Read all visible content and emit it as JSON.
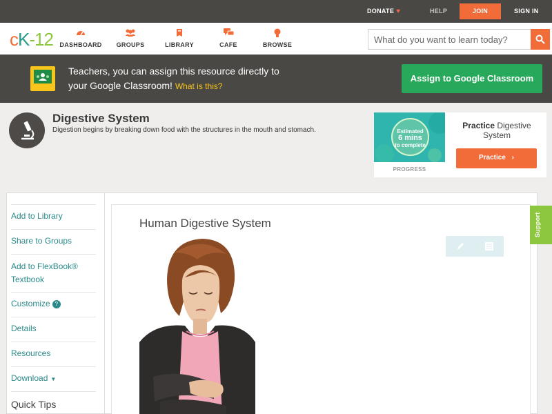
{
  "topbar": {
    "donate": "DONATE",
    "help": "HELP",
    "join": "JOIN",
    "signin": "SIGN IN"
  },
  "logo": {
    "c": "c",
    "k": "K",
    "dash": "-",
    "num": "12"
  },
  "nav": {
    "items": [
      {
        "label": "DASHBOARD",
        "icon": "dashboard-icon"
      },
      {
        "label": "GROUPS",
        "icon": "groups-icon"
      },
      {
        "label": "LIBRARY",
        "icon": "library-icon"
      },
      {
        "label": "CAFE",
        "icon": "cafe-icon"
      },
      {
        "label": "BROWSE",
        "icon": "browse-icon"
      }
    ],
    "search_placeholder": "What do you want to learn today?"
  },
  "banner": {
    "line1": "Teachers, you can assign this resource directly to",
    "line2": "your Google Classroom!",
    "what": "What is this?",
    "assign": "Assign to Google Classroom"
  },
  "concept": {
    "title": "Digestive System",
    "description": "Digestion begins by breaking down food with the structures in the mouth and stomach."
  },
  "practice": {
    "estimated": "Estimated",
    "mins": "6 mins",
    "to_complete": "to complete",
    "progress": "PROGRESS",
    "title_bold": "Practice",
    "title_rest": "Digestive System",
    "button": "Practice"
  },
  "sidebar": {
    "items": [
      {
        "label": "Add to Library"
      },
      {
        "label": "Share to Groups"
      },
      {
        "label": "Add to FlexBook® Textbook"
      },
      {
        "label": "Customize"
      },
      {
        "label": "Details"
      },
      {
        "label": "Resources"
      },
      {
        "label": "Download"
      }
    ],
    "quick_tips": "Quick Tips"
  },
  "main": {
    "title": "Human Digestive System"
  },
  "support": "Support",
  "colors": {
    "accent": "#f26c3a",
    "green": "#27a85a",
    "link": "#2a8a8a",
    "dark": "#4a4845"
  }
}
